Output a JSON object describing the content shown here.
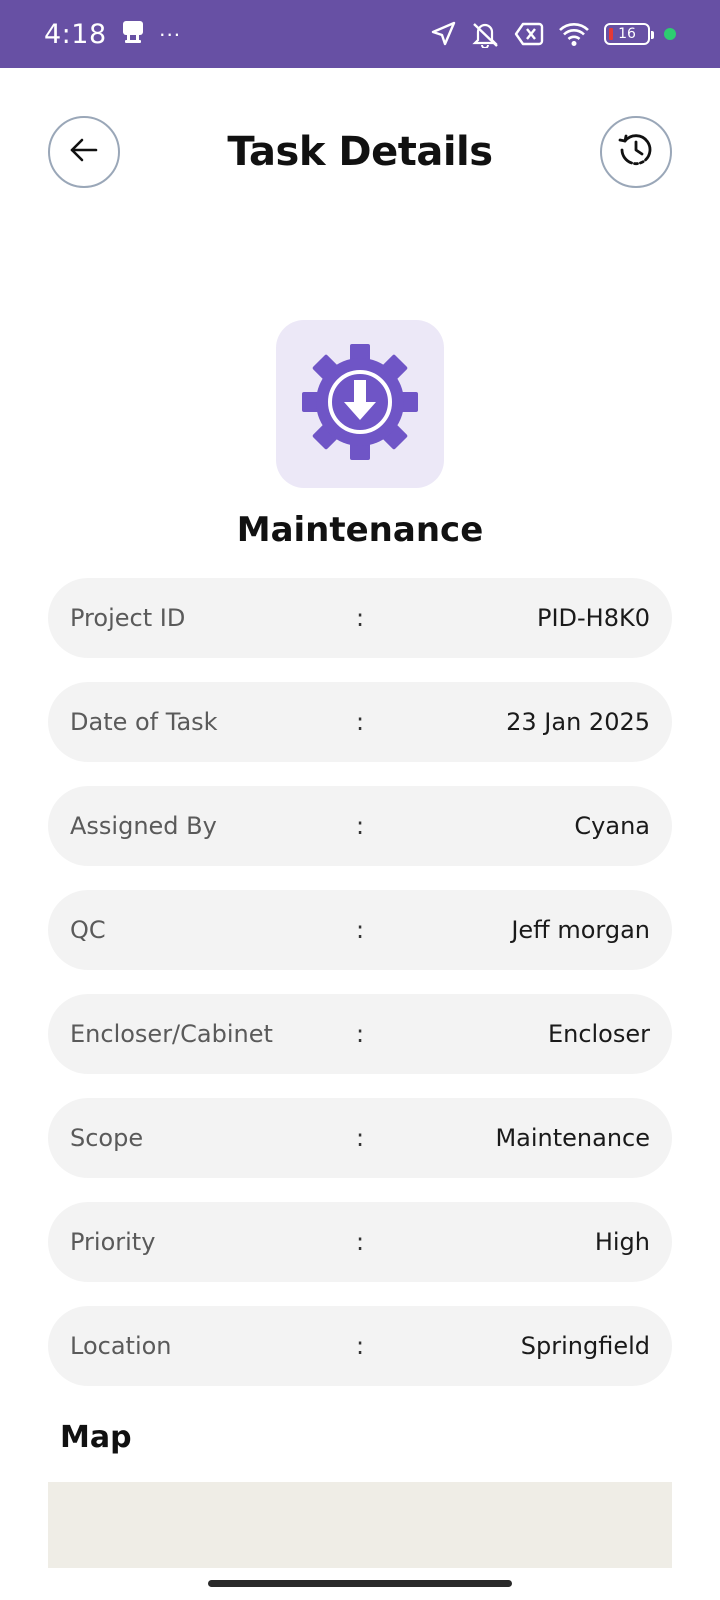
{
  "status_bar": {
    "time": "4:18",
    "more_dots": "···",
    "battery_level": "16",
    "icons": [
      "notification-app-icon",
      "location-arrow-icon",
      "mute-icon",
      "sim-x-icon",
      "wifi-icon",
      "battery-icon"
    ],
    "colors": {
      "background": "#6750a4",
      "dot": "#2ecc71"
    }
  },
  "header": {
    "title": "Task Details",
    "back_icon": "arrow-left-icon",
    "history_icon": "history-clock-icon"
  },
  "task": {
    "icon": "gear-download-icon",
    "type": "Maintenance",
    "accent_color": "#6f55c6"
  },
  "details": [
    {
      "label": "Project ID",
      "separator": ":",
      "value": "PID-H8K0"
    },
    {
      "label": "Date of Task",
      "separator": ":",
      "value": "23 Jan 2025"
    },
    {
      "label": "Assigned By",
      "separator": ":",
      "value": "Cyana"
    },
    {
      "label": "QC",
      "separator": ":",
      "value": "Jeff morgan"
    },
    {
      "label": "Encloser/Cabinet",
      "separator": ":",
      "value": "Encloser"
    },
    {
      "label": "Scope",
      "separator": ":",
      "value": "Maintenance"
    },
    {
      "label": "Priority",
      "separator": ":",
      "value": "High"
    },
    {
      "label": "Location",
      "separator": ":",
      "value": "Springfield"
    }
  ],
  "map": {
    "title": "Map"
  }
}
